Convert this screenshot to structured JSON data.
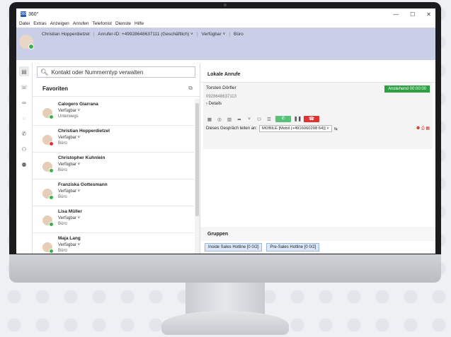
{
  "window": {
    "title": "360°",
    "app_icon": "360",
    "controls": [
      "—",
      "☐",
      "✕"
    ]
  },
  "menu": [
    "Datei",
    "Extras",
    "Anzeigen",
    "Anrufen",
    "Telefonist",
    "Dienste",
    "Hilfe"
  ],
  "header": {
    "user": "Christian Hopperdietzel",
    "caller_id": "Anrufer-ID: +49928648637111 (Geschäftlich) ˅",
    "status": "Verfügbar ˅",
    "location": "Büro"
  },
  "search": {
    "placeholder": "Kontakt oder Nummerntyp verwalten"
  },
  "favorites": {
    "title": "Favoriten",
    "contacts": [
      {
        "name": "Calogero Giarrana",
        "status": "Verfügbar ˅",
        "location": "Unterwegs",
        "presence": "#3cae4b"
      },
      {
        "name": "Christian Hopperdietzel",
        "status": "Verfügbar ˅",
        "location": "Büro",
        "presence": "#e0322f"
      },
      {
        "name": "Christopher Kuhnlein",
        "status": "Verfügbar ˅",
        "location": "Büro",
        "presence": "#3cae4b"
      },
      {
        "name": "Franziska Gottesmann",
        "status": "Verfügbar ˅",
        "location": "Büro",
        "presence": "#3cae4b"
      },
      {
        "name": "Lisa Müller",
        "status": "Verfügbar ˅",
        "location": "Büro",
        "presence": "#3cae4b"
      },
      {
        "name": "Maja Lang",
        "status": "Verfügbar ˅",
        "location": "Büro",
        "presence": "#3cae4b"
      }
    ]
  },
  "local_calls": {
    "title": "Lokale Anrufe",
    "caller": "Torsten Dörfler",
    "state": "Anstehend 00:00:00",
    "number": "0928648637113",
    "details": "Details",
    "forward_label": "Dieses Gespräch leiten an:",
    "forward_target": "MOBILE [Mobil (+4916060208 64)] ˅"
  },
  "groups": {
    "title": "Gruppen",
    "items": [
      "Inside Sales Hotline [0 0/2]",
      "Pre-Sales Hotline [0 0/2]"
    ]
  },
  "colors": {
    "accent": "#2c5aa8",
    "header_bg": "#c9cfe6",
    "state_green": "#2ea044",
    "hangup_red": "#e0322f"
  }
}
